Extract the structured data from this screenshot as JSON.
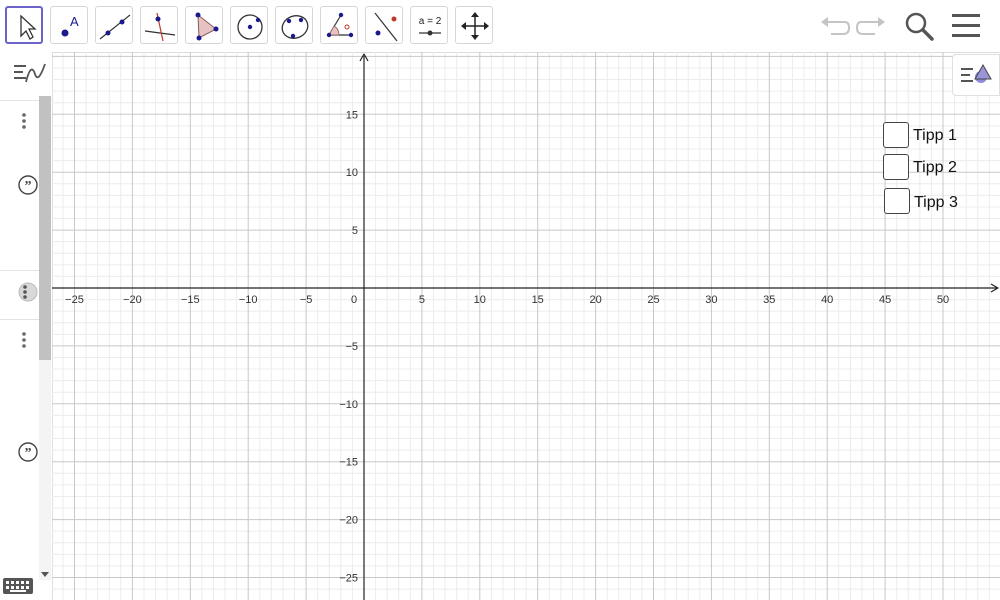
{
  "toolbar": {
    "tools": [
      {
        "name": "move-tool",
        "selected": true
      },
      {
        "name": "point-tool"
      },
      {
        "name": "line-tool"
      },
      {
        "name": "perpendicular-line-tool"
      },
      {
        "name": "polygon-tool"
      },
      {
        "name": "circle-center-point-tool"
      },
      {
        "name": "conic-through-points-tool"
      },
      {
        "name": "angle-tool"
      },
      {
        "name": "reflect-about-line-tool"
      },
      {
        "name": "slider-tool",
        "label": "a = 2"
      },
      {
        "name": "move-graphics-view-tool"
      }
    ],
    "right_icons": [
      "undo-icon",
      "redo-icon",
      "search-icon",
      "menu-icon"
    ]
  },
  "algebra_view": {
    "icons": [
      "algebra-stylebar-icon",
      "more-vertical-icon",
      "quote-icon",
      "visibility-toggle-icon",
      "more-vertical-icon",
      "quote-icon",
      "keyboard-icon",
      "scroll-down-icon"
    ]
  },
  "graphics_view": {
    "x_ticks": [
      "−25",
      "−20",
      "−15",
      "−10",
      "−5",
      "0",
      "5",
      "10",
      "15",
      "20",
      "25",
      "30",
      "35",
      "40",
      "45",
      "50"
    ],
    "y_ticks_pos": [
      "15",
      "10",
      "5"
    ],
    "y_ticks_neg": [
      "−5",
      "−10",
      "−15",
      "−20",
      "−25"
    ],
    "grid": true,
    "stylebar_icon": "graphics-stylebar-icon"
  },
  "checkboxes": [
    {
      "label": "Tipp 1",
      "checked": false
    },
    {
      "label": "Tipp 2",
      "checked": false
    },
    {
      "label": "Tipp 3",
      "checked": false
    }
  ]
}
